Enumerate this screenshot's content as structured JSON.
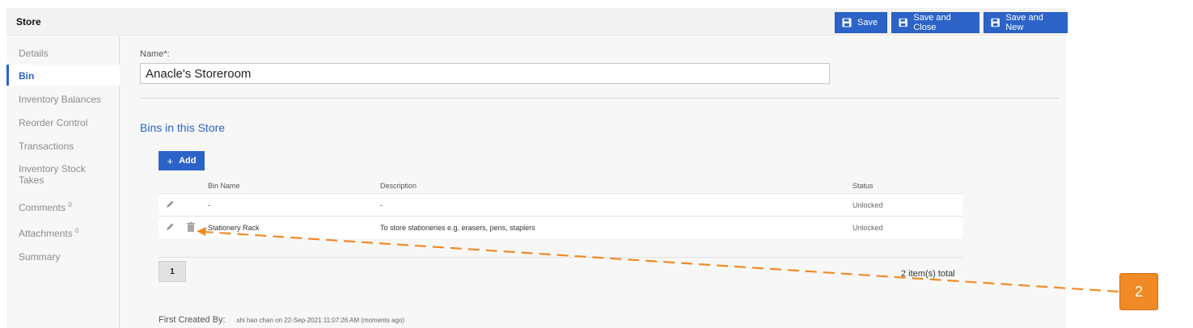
{
  "header": {
    "title": "Store",
    "buttons": {
      "save": "Save",
      "save_close": "Save and Close",
      "save_new": "Save and New"
    }
  },
  "sidebar": {
    "items": [
      {
        "label": "Details"
      },
      {
        "label": "Bin",
        "active": true
      },
      {
        "label": "Inventory Balances"
      },
      {
        "label": "Reorder Control"
      },
      {
        "label": "Transactions"
      },
      {
        "label": "Inventory Stock Takes"
      },
      {
        "label": "Comments",
        "count": "0"
      },
      {
        "label": "Attachments",
        "count": "0"
      },
      {
        "label": "Summary"
      }
    ]
  },
  "form": {
    "name_label": "Name*:",
    "name_value": "Anacle's Storeroom"
  },
  "bins": {
    "section_title": "Bins in this Store",
    "add_label": "Add",
    "columns": {
      "bin_name": "Bin Name",
      "description": "Description",
      "status": "Status"
    },
    "rows": [
      {
        "bin_name": "-",
        "description": "-",
        "status": "Unlocked"
      },
      {
        "bin_name": "Stationery Rack",
        "description": "To store stationeries e.g. erasers, pens, staplers",
        "status": "Unlocked"
      }
    ],
    "page": "1",
    "total": "2 item(s) total"
  },
  "footer": {
    "created_label": "First Created By:",
    "created_value": "shi hao chan on 22-Sep-2021 11:07:26 AM (moments ago)"
  },
  "callout": {
    "number": "2",
    "color": "#ef8a25"
  },
  "colors": {
    "accent": "#2c63c9",
    "sidebar_bg": "#f7f7f7"
  }
}
